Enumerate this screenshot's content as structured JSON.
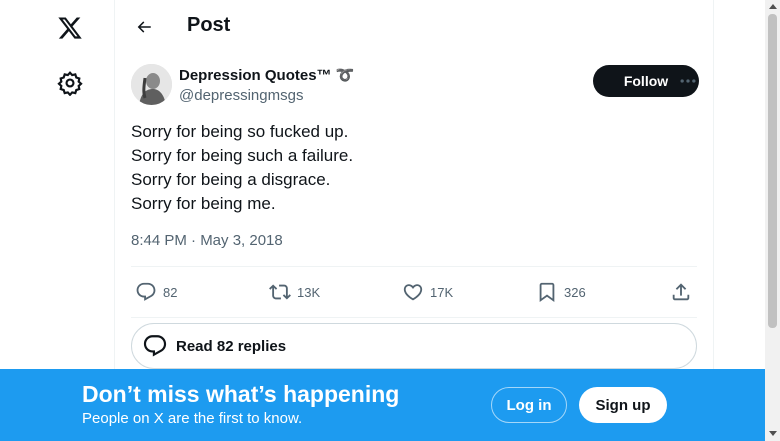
{
  "nav": {
    "logo_icon": "x-logo-icon",
    "settings_icon": "gear-icon"
  },
  "header": {
    "title": "Post",
    "back_icon": "arrow-left-icon"
  },
  "tweet": {
    "display_name": "Depression Quotes™",
    "name_emoji": "➰",
    "handle": "@depressingmsgs",
    "follow_label": "Follow",
    "more_icon": "ellipsis-icon",
    "lines": [
      "Sorry for being so fucked up.",
      "Sorry for being such a failure.",
      "Sorry for being a disgrace.",
      "Sorry for being me."
    ],
    "timestamp": "8:44 PM · May 3, 2018",
    "stats": {
      "replies": "82",
      "reposts": "13K",
      "likes": "17K",
      "bookmarks": "326"
    },
    "read_replies_label": "Read 82 replies"
  },
  "banner": {
    "title": "Don’t miss what’s happening",
    "subtitle": "People on X are the first to know.",
    "login_label": "Log in",
    "signup_label": "Sign up"
  },
  "colors": {
    "accent": "#1d9bf0",
    "text": "#0f1419",
    "muted": "#536471",
    "border": "#eff3f4"
  }
}
